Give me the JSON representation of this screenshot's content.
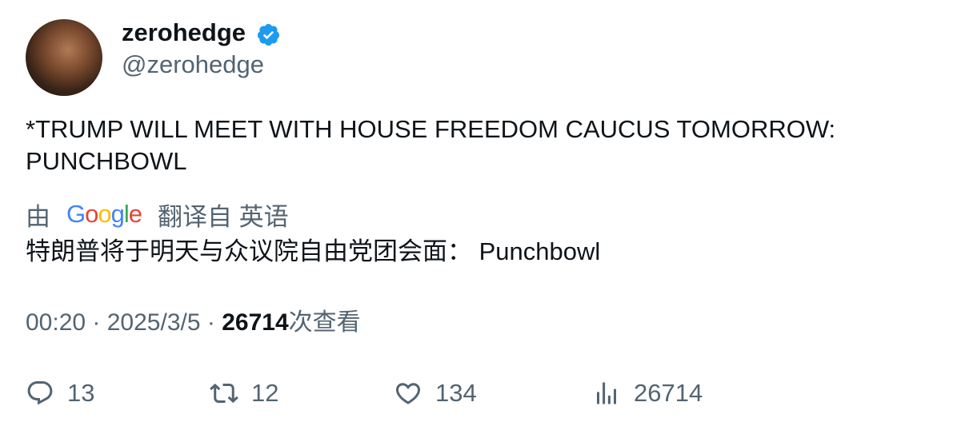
{
  "author": {
    "name": "zerohedge",
    "handle": "@zerohedge",
    "verified_color": "#1d9bf0"
  },
  "tweet": {
    "text": "*TRUMP WILL MEET WITH HOUSE FREEDOM CAUCUS TOMORROW: PUNCHBOWL"
  },
  "translation": {
    "by_label": "由",
    "provider": "Google",
    "from_label": "翻译自 英语",
    "text": "特朗普将于明天与众议院自由党团会面： Punchbowl"
  },
  "meta": {
    "time": "00:20",
    "date": "2025/3/5",
    "views": "26714",
    "views_suffix": "次查看"
  },
  "actions": {
    "replies": "13",
    "retweets": "12",
    "likes": "134",
    "views": "26714"
  }
}
